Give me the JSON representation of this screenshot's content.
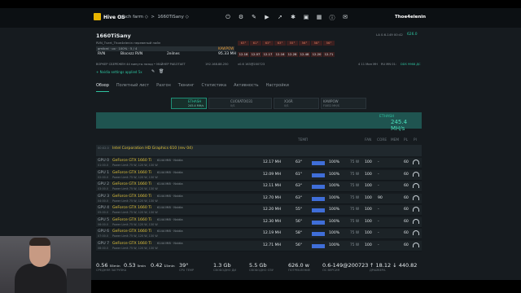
{
  "topbar": {
    "brand": "Hive OS",
    "crumb1": "gach farm ◇",
    "crumb2": "1660TiSany ◇",
    "user": "Thoe4elenin",
    "icons": [
      "power-icon",
      "settings-icon",
      "wrench-icon",
      "play-icon",
      "rocket-icon",
      "gear-icon",
      "terminal-icon",
      "grid-icon",
      "info-icon",
      "mail-icon"
    ]
  },
  "rig": {
    "name": "1660TiSany",
    "wallet_line": "RVN_Tvert_Thoe4elenin",
    "wallet_sub": "перевеный найл",
    "pool_row": "gmlbrd · uo · 100% · 5 / 4",
    "coin": "RVN",
    "pool": "Blocezz RVN",
    "workers": "2eilnes",
    "algo_badge": "KAWPOW",
    "hashrate": "95.33 MH",
    "temps_header": [
      "63°",
      "61°",
      "63°",
      "63°",
      "55°",
      "56°",
      "58°",
      "56°"
    ],
    "hash_values": [
      "12.18",
      "12.07",
      "12.17",
      "12.16",
      "12.28",
      "12.48",
      "12.20",
      "12.71"
    ],
    "version": "LA 0.6-149 00:42",
    "right_val": "626.0",
    "info_line": "ВОРКЕР СБЕРЕЖЕН 44 минуты назад  •  МАЙНЕР РАБОТАЕТ",
    "info_ip": "192.168.88.250",
    "info_ver": "v0.6 163@200723",
    "info_right1": "4 11 Мин MH",
    "info_right2": "RU MN 01:",
    "info_right3": "DDS 9968 ДС",
    "profile_note": "+ Nvidia settings applied 5x",
    "pencil_icon": "pencil-icon"
  },
  "tabs": [
    "Обзор",
    "Полетный лист",
    "Разгон",
    "Тюнинг",
    "Статистика",
    "Активность",
    "Настройки"
  ],
  "algo_cards": [
    {
      "title": "ETHASH",
      "sub": "245.4 MH/s",
      "active": true
    },
    {
      "title": "CUCKATOO31",
      "sub": "0/S",
      "active": false
    },
    {
      "title": "X16R",
      "sub": "0/S",
      "active": false
    },
    {
      "title": "KAWPOW",
      "sub": "FIXED MH/S",
      "active": false
    }
  ],
  "summary": {
    "label": "ETHASH",
    "value": "245.4 MH/s"
  },
  "table_headers": [
    "ТЕМП",
    "FAN",
    "CORE",
    "MEM",
    "PL",
    "Pl"
  ],
  "intel": {
    "name": "Intel Corporation HD Graphics 610 (rev 04)",
    "index": "00:02.0"
  },
  "gpus": [
    {
      "id": "GPU 0",
      "bus": "01:00.0",
      "model": "GeForce GTX 1660 Ti",
      "mem": "6144 MiB · Nvidia",
      "sub": "Power Limit 75 W, 120 W, 130 W",
      "hash": "12.17 MH",
      "temp": "63°",
      "fan": "100%",
      "pw": "75 W",
      "core": "100",
      "memclk": "-",
      "pl": "60"
    },
    {
      "id": "GPU 1",
      "bus": "02:00.0",
      "model": "GeForce GTX 1660 Ti",
      "mem": "6144 MiB · Nvidia",
      "sub": "Power Limit 75 W, 120 W, 130 W",
      "hash": "12.09 MH",
      "temp": "61°",
      "fan": "100%",
      "pw": "75 W",
      "core": "100",
      "memclk": "-",
      "pl": "60"
    },
    {
      "id": "GPU 2",
      "bus": "03:00.0",
      "model": "GeForce GTX 1660 Ti",
      "mem": "6144 MiB · Nvidia",
      "sub": "Power Limit 75 W, 120 W, 130 W",
      "hash": "12.11 MH",
      "temp": "63°",
      "fan": "100%",
      "pw": "75 W",
      "core": "100",
      "memclk": "-",
      "pl": "60"
    },
    {
      "id": "GPU 3",
      "bus": "04:00.0",
      "model": "GeForce GTX 1660 Ti",
      "mem": "6144 MiB · Nvidia",
      "sub": "Power Limit 75 W, 120 W, 130 W",
      "hash": "12.70 MH",
      "temp": "63°",
      "fan": "100%",
      "pw": "75 W",
      "core": "100",
      "memclk": "90",
      "pl": "60"
    },
    {
      "id": "GPU 4",
      "bus": "05:00.0",
      "model": "GeForce GTX 1660 Ti",
      "mem": "6144 MiB · Nvidia",
      "sub": "Power Limit 75 W, 120 W, 130 W",
      "hash": "12.20 MH",
      "temp": "55°",
      "fan": "100%",
      "pw": "75 W",
      "core": "100",
      "memclk": "-",
      "pl": "60"
    },
    {
      "id": "GPU 5",
      "bus": "06:00.0",
      "model": "GeForce GTX 1660 Ti",
      "mem": "6144 MiB · Nvidia",
      "sub": "Power Limit 75 W, 120 W, 130 W",
      "hash": "12.30 MH",
      "temp": "56°",
      "fan": "100%",
      "pw": "75 W",
      "core": "100",
      "memclk": "-",
      "pl": "60"
    },
    {
      "id": "GPU 6",
      "bus": "07:00.0",
      "model": "GeForce GTX 1660 Ti",
      "mem": "6144 MiB · Nvidia",
      "sub": "Power Limit 75 W, 120 W, 130 W",
      "hash": "12.19 MH",
      "temp": "58°",
      "fan": "100%",
      "pw": "75 W",
      "core": "100",
      "memclk": "-",
      "pl": "60"
    },
    {
      "id": "GPU 7",
      "bus": "08:00.0",
      "model": "GeForce GTX 1660 Ti",
      "mem": "6144 MiB · Nvidia",
      "sub": "Power Limit 75 W, 120 W, 130 W",
      "hash": "12.71 MH",
      "temp": "56°",
      "fan": "100%",
      "pw": "75 W",
      "core": "100",
      "memclk": "-",
      "pl": "60"
    }
  ],
  "bottom": [
    {
      "v": "0.56 ₅₅ₘᵢₙ",
      "l": "СРЕДНЯЯ ЗАГРУЗКА"
    },
    {
      "v": "0.53 ₅ₘᵢₙ",
      "l": ""
    },
    {
      "v": "0.42 ₁₅ₘᵢₙ",
      "l": ""
    },
    {
      "v": "39°",
      "l": "CPU TEMP"
    },
    {
      "v": "1.3 Gb",
      "l": "СВОБОДНО ДИ"
    },
    {
      "v": "5.5 Gb",
      "l": "СВОБОДНО ОЗУ"
    },
    {
      "v": "626.0 w",
      "l": "ПОТРЕБЛЕНИЕ"
    },
    {
      "v": "0.6-149@200723",
      "l": "ОС ВЕРСИЯ"
    },
    {
      "v": "↑ 18.12 ↓ 440.82",
      "l": "ДРАЙВЕРА"
    }
  ],
  "colors": {
    "accent": "#2ec4a0",
    "bg": "#161b1f",
    "topbar": "#0c1013",
    "gpu_name": "#e0c23a",
    "fan_bar": "#3f6ed8"
  }
}
